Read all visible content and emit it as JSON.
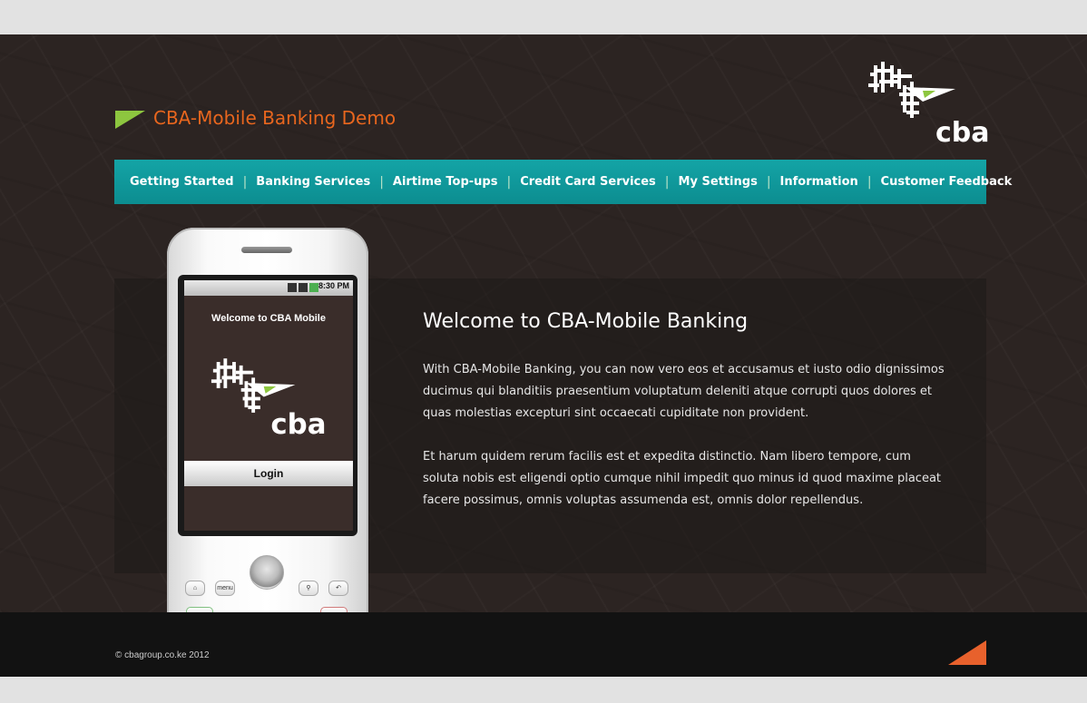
{
  "header": {
    "site_title": "CBA-Mobile Banking Demo",
    "logo_text": "cba"
  },
  "nav": {
    "items": [
      {
        "label": "Getting Started"
      },
      {
        "label": "Banking Services"
      },
      {
        "label": "Airtime Top-ups"
      },
      {
        "label": "Credit Card Services"
      },
      {
        "label": "My Settings"
      },
      {
        "label": "Information"
      },
      {
        "label": "Customer Feedback"
      }
    ]
  },
  "phone": {
    "status_time": "8:30 PM",
    "welcome": "Welcome to CBA Mobile",
    "logo_text": "cba",
    "login_label": "Login",
    "menu_label": "menu"
  },
  "main": {
    "heading": "Welcome to CBA-Mobile Banking",
    "paragraphs": [
      "With CBA-Mobile Banking, you can now vero eos et accusamus et iusto odio dignissimos ducimus qui blanditiis praesentium voluptatum deleniti atque corrupti quos dolores et quas molestias excepturi sint occaecati cupiditate non provident.",
      "Et harum quidem rerum facilis est et expedita distinctio. Nam libero tempore, cum soluta nobis est eligendi optio cumque nihil impedit quo minus id quod maxime placeat facere possimus, omnis voluptas assumenda est, omnis dolor repellendus."
    ]
  },
  "footer": {
    "copyright": "© cbagroup.co.ke 2012"
  },
  "colors": {
    "accent_orange": "#e8661e",
    "nav_teal": "#0f9a9c",
    "flag_green": "#8dc63f",
    "background": "#2c2422"
  }
}
